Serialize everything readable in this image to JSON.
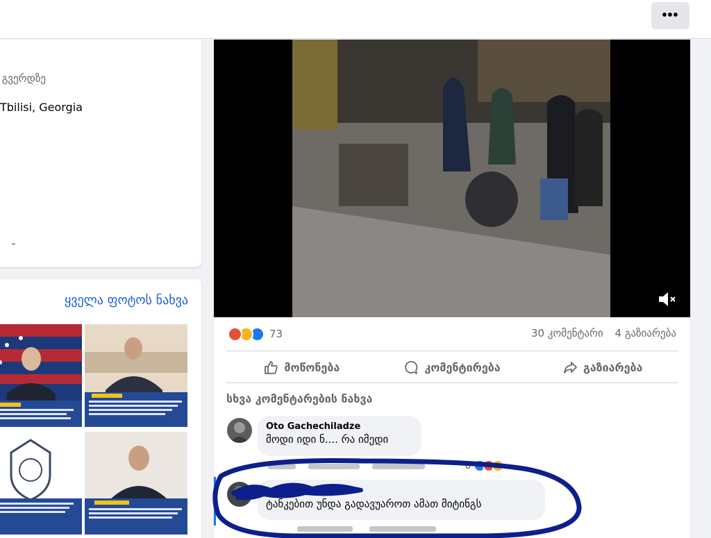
{
  "topbar": {
    "more_label": "•••"
  },
  "intro": {
    "line1": "მ გვერდზე",
    "location": "Tbilisi, Georgia"
  },
  "photos": {
    "see_all_label": "ყველა ფოტოს ნახვა"
  },
  "post": {
    "reaction_count": "73",
    "comments_count": "30 კომენტარი",
    "shares_count": "4 გაზიარება",
    "like_label": "მოწონება",
    "comment_label": "კომენტირება",
    "share_label": "გაზიარება",
    "more_comments_label": "სხვა კომენტარების ნახვა"
  },
  "comments": [
    {
      "name": "Oto Gachechiladze",
      "text": "მოდი იდი ნ.... რა იმედი",
      "meta_time": "",
      "meta_reply": "",
      "reaction_count": "8"
    },
    {
      "name": "",
      "text": "ტანკებით უნდა გადავუაროთ ამათ მიტინგს"
    }
  ],
  "colors": {
    "accent": "#1a5fd1",
    "circle": "#0d1f8c"
  }
}
